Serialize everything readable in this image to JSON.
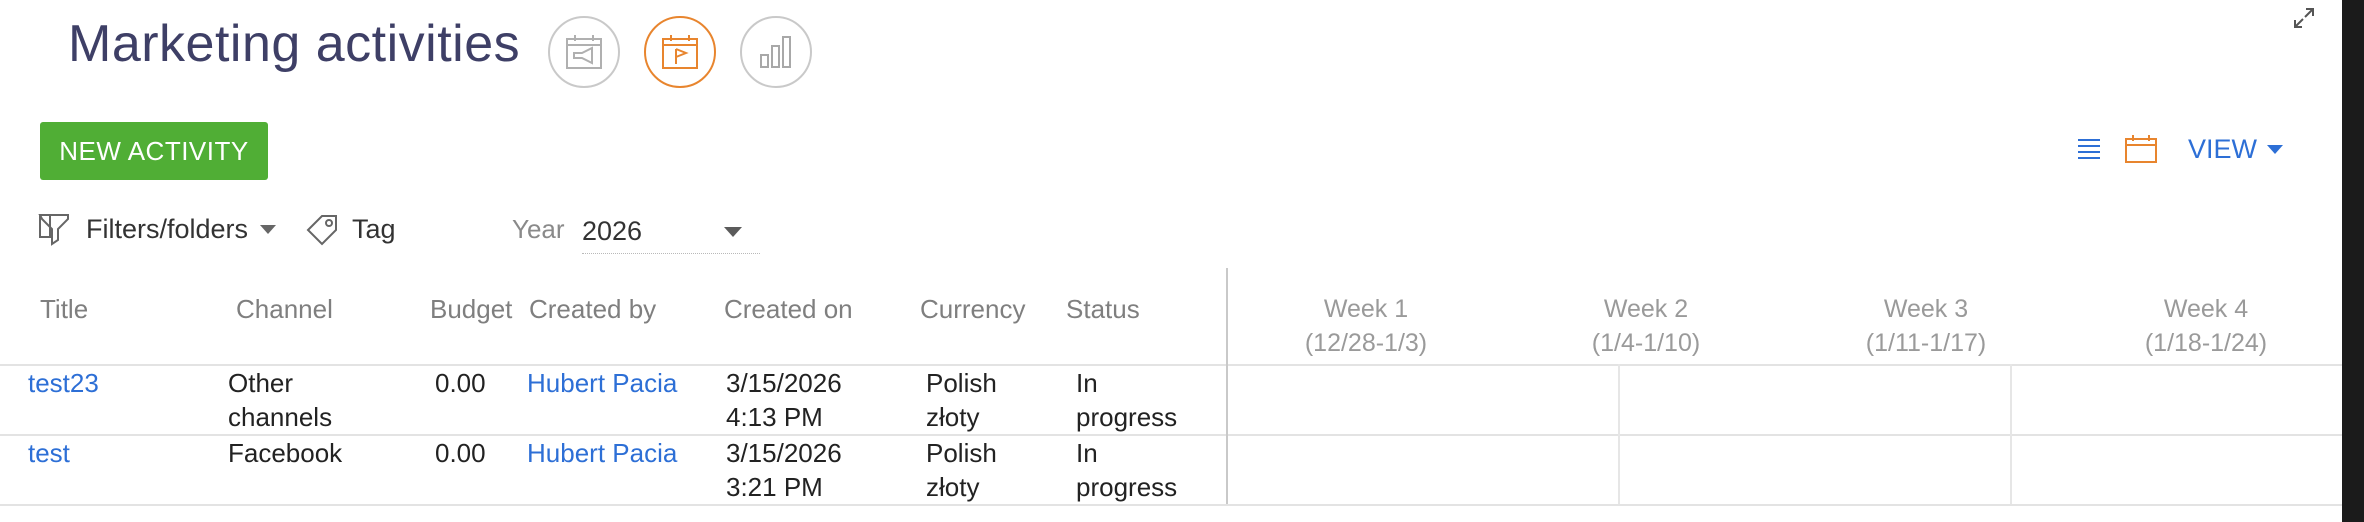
{
  "header": {
    "title": "Marketing activities",
    "nav_buttons": [
      {
        "icon": "megaphone-calendar-icon",
        "active": false
      },
      {
        "icon": "calendar-flag-icon",
        "active": true
      },
      {
        "icon": "bar-chart-icon",
        "active": false
      }
    ]
  },
  "toolbar": {
    "new_label": "NEW ACTIVITY",
    "view_label": "VIEW",
    "list_icon": "list-view-icon",
    "calendar_icon": "calendar-view-icon"
  },
  "filters": {
    "filters_label": "Filters/folders",
    "tag_label": "Tag",
    "year_label": "Year",
    "year_value": "2026"
  },
  "columns": [
    "Title",
    "Channel",
    "Budget",
    "Created by",
    "Created on",
    "Currency",
    "Status"
  ],
  "weeks": [
    {
      "label": "Week 1",
      "range": "(12/28-1/3)"
    },
    {
      "label": "Week 2",
      "range": "(1/4-1/10)"
    },
    {
      "label": "Week 3",
      "range": "(1/11-1/17)"
    },
    {
      "label": "Week 4",
      "range": "(1/18-1/24)"
    }
  ],
  "rows": [
    {
      "title": "test23",
      "channel": [
        "Other",
        "channels"
      ],
      "budget": "0.00",
      "created_by": "Hubert Pacia",
      "created_on": [
        "3/15/2026",
        "4:13 PM"
      ],
      "currency": [
        "Polish",
        "złoty"
      ],
      "status": [
        "In",
        "progress"
      ]
    },
    {
      "title": "test",
      "channel": [
        "Facebook"
      ],
      "budget": "0.00",
      "created_by": "Hubert Pacia",
      "created_on": [
        "3/15/2026",
        "3:21 PM"
      ],
      "currency": [
        "Polish",
        "złoty"
      ],
      "status": [
        "In",
        "progress"
      ]
    }
  ],
  "colors": {
    "accent_green": "#50ae35",
    "accent_orange": "#e8852e",
    "link_blue": "#2d6fd6",
    "title_navy": "#3e3f66"
  }
}
